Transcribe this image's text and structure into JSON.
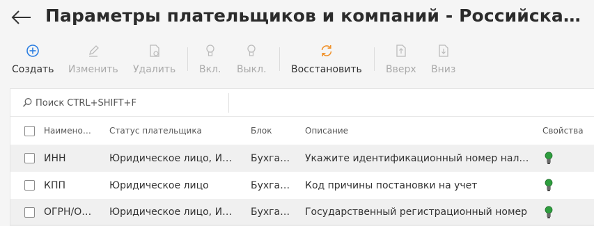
{
  "header": {
    "title": "Параметры плательщиков и компаний - Российская Федерация"
  },
  "toolbar": {
    "create": "Создать",
    "edit": "Изменить",
    "delete": "Удалить",
    "enable": "Вкл.",
    "disable": "Выкл.",
    "restore": "Восстановить",
    "up": "Вверх",
    "down": "Вниз"
  },
  "search": {
    "placeholder": "Поиск CTRL+SHIFT+F"
  },
  "columns": {
    "name": "Наименование",
    "payer_status": "Статус плательщика",
    "block": "Блок",
    "description": "Описание",
    "properties": "Свойства"
  },
  "rows": [
    {
      "name": "ИНН",
      "payer_status": "Юридическое лицо, Индивидуальный предприниматель",
      "block": "Бухгалтерия",
      "description": "Укажите идентификационный номер налогоплательщика",
      "property_icon": "lightbulb-on-icon"
    },
    {
      "name": "КПП",
      "payer_status": "Юридическое лицо",
      "block": "Бухгалтерия",
      "description": "Код причины постановки на учет",
      "property_icon": "lightbulb-on-icon"
    },
    {
      "name": "ОГРН/ОГРНИП",
      "payer_status": "Юридическое лицо, Индивидуальный предприниматель",
      "block": "Бухгалтерия",
      "description": "Государственный регистрационный номер",
      "property_icon": "lightbulb-on-icon"
    }
  ],
  "colors": {
    "accent": "#2a7de1",
    "restore_icon": "#f0922b",
    "bulb_on": "#2e9e3e",
    "disabled": "#aaaaaa"
  }
}
